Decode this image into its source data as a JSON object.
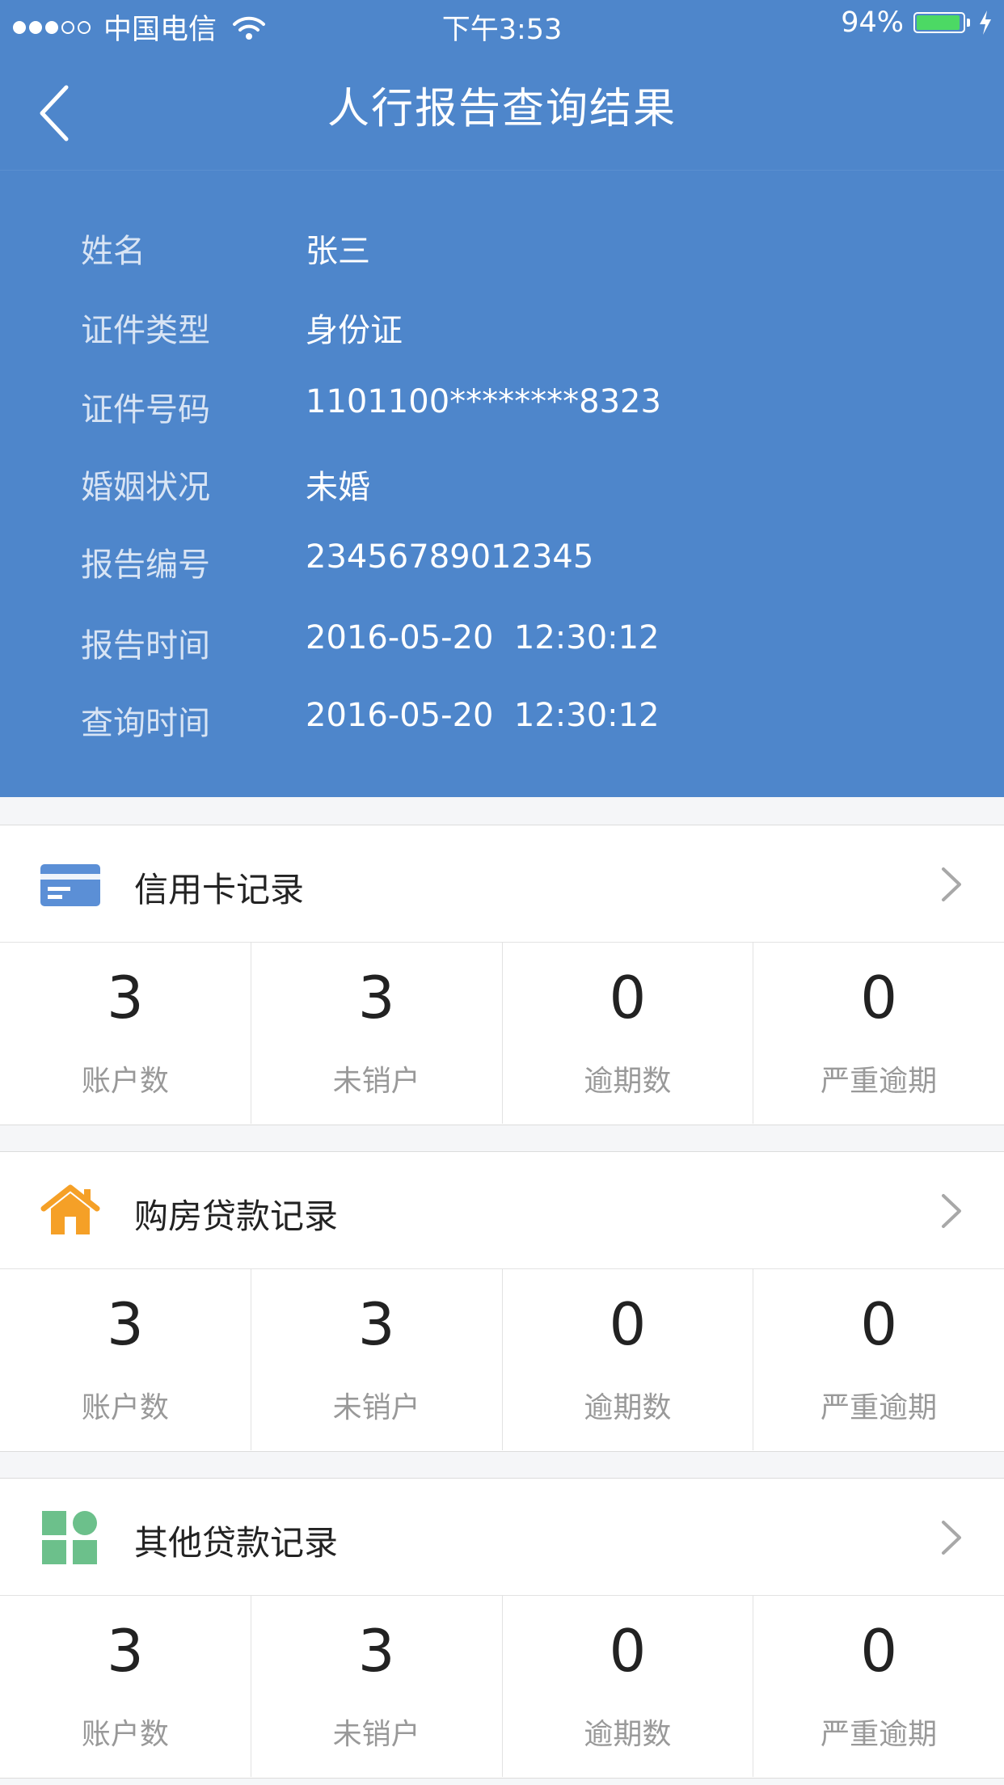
{
  "statusbar": {
    "carrier": "中国电信",
    "time": "下午3:53",
    "battery": "94%",
    "battery_level": 0.94,
    "colors": {
      "battery_fill": "#4cd964"
    }
  },
  "navbar": {
    "title": "人行报告查询结果",
    "back_icon": "chevron-left-icon"
  },
  "info": {
    "rows": [
      {
        "label": "姓名",
        "value": "张三"
      },
      {
        "label": "证件类型",
        "value": "身份证"
      },
      {
        "label": "证件号码",
        "value": "1101100********8323"
      },
      {
        "label": "婚姻状况",
        "value": "未婚"
      },
      {
        "label": "报告编号",
        "value": "23456789012345"
      },
      {
        "label": "报告时间",
        "value": "2016-05-20  12:30:12"
      },
      {
        "label": "查询时间",
        "value": "2016-05-20  12:30:12"
      }
    ]
  },
  "sections": [
    {
      "title": "信用卡记录",
      "icon": "credit-card-icon",
      "color": "#5b8fd6",
      "stats": [
        {
          "value": "3",
          "label": "账户数"
        },
        {
          "value": "3",
          "label": "未销户"
        },
        {
          "value": "0",
          "label": "逾期数"
        },
        {
          "value": "0",
          "label": "严重逾期"
        }
      ]
    },
    {
      "title": "购房贷款记录",
      "icon": "house-icon",
      "color": "#f5a027",
      "stats": [
        {
          "value": "3",
          "label": "账户数"
        },
        {
          "value": "3",
          "label": "未销户"
        },
        {
          "value": "0",
          "label": "逾期数"
        },
        {
          "value": "0",
          "label": "严重逾期"
        }
      ]
    },
    {
      "title": "其他贷款记录",
      "icon": "grid-icon",
      "color": "#6cc08b",
      "stats": [
        {
          "value": "3",
          "label": "账户数"
        },
        {
          "value": "3",
          "label": "未销户"
        },
        {
          "value": "0",
          "label": "逾期数"
        },
        {
          "value": "0",
          "label": "严重逾期"
        }
      ]
    }
  ]
}
